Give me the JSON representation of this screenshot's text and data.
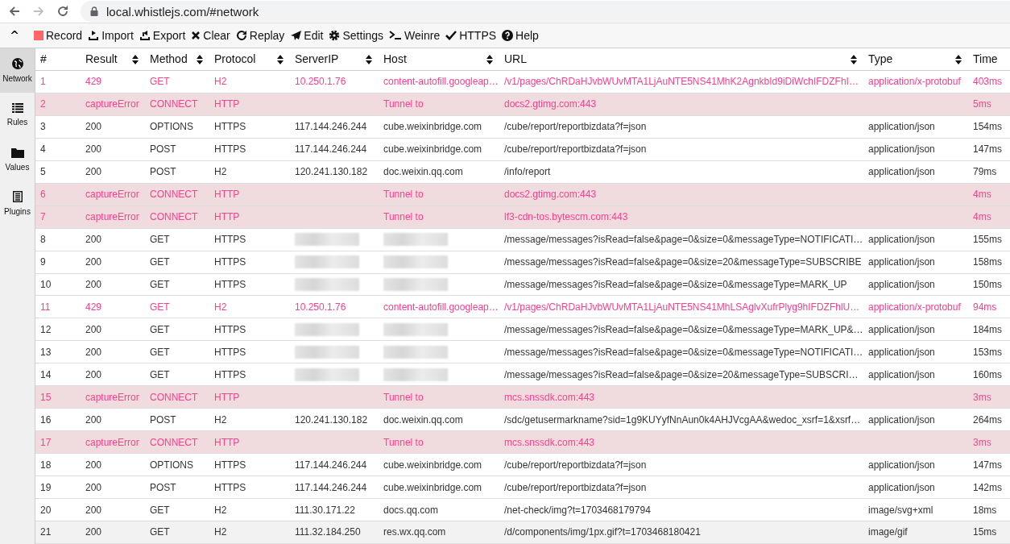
{
  "browser": {
    "back_disabled": false,
    "forward_disabled": true,
    "url": "local.whistlejs.com/#network"
  },
  "toolbar": {
    "collapse": "^",
    "items": [
      {
        "label": "Record"
      },
      {
        "label": "Import"
      },
      {
        "label": "Export"
      },
      {
        "label": "Clear"
      },
      {
        "label": "Replay"
      },
      {
        "label": "Edit"
      },
      {
        "label": "Settings"
      },
      {
        "label": "Weinre"
      },
      {
        "label": "HTTPS"
      },
      {
        "label": "Help"
      }
    ]
  },
  "sidebar": {
    "items": [
      {
        "label": "Network",
        "selected": true
      },
      {
        "label": "Rules",
        "selected": false
      },
      {
        "label": "Values",
        "selected": false
      },
      {
        "label": "Plugins",
        "selected": false
      }
    ]
  },
  "table": {
    "columns": [
      {
        "label": "#",
        "sortable": false
      },
      {
        "label": "Result",
        "sortable": true
      },
      {
        "label": "Method",
        "sortable": true
      },
      {
        "label": "Protocol",
        "sortable": true
      },
      {
        "label": "ServerIP",
        "sortable": true
      },
      {
        "label": "Host",
        "sortable": true
      },
      {
        "label": "URL",
        "sortable": true
      },
      {
        "label": "Type",
        "sortable": true
      },
      {
        "label": "Time",
        "sortable": false
      }
    ],
    "rows": [
      {
        "kind": "warning",
        "selected": false,
        "redacted": false,
        "cells": [
          "1",
          "429",
          "GET",
          "H2",
          "10.250.1.76",
          "content-autofill.googleap…",
          "/v1/pages/ChRDaHJvbWUvMTA1LjAuNTE5NS41MhK2AgnkbId9iDiWchIFDZFhI…",
          "application/x-protobuf",
          "403ms"
        ]
      },
      {
        "kind": "error",
        "selected": false,
        "redacted": false,
        "cells": [
          "2",
          "captureError",
          "CONNECT",
          "HTTP",
          "",
          "Tunnel to",
          "docs2.gtimg.com:443",
          "",
          "5ms"
        ]
      },
      {
        "kind": "normal",
        "selected": false,
        "redacted": false,
        "cells": [
          "3",
          "200",
          "OPTIONS",
          "HTTPS",
          "117.144.246.244",
          "cube.weixinbridge.com",
          "/cube/report/reportbizdata?f=json",
          "application/json",
          "154ms"
        ]
      },
      {
        "kind": "normal",
        "selected": false,
        "redacted": false,
        "cells": [
          "4",
          "200",
          "POST",
          "HTTPS",
          "117.144.246.244",
          "cube.weixinbridge.com",
          "/cube/report/reportbizdata?f=json",
          "application/json",
          "147ms"
        ]
      },
      {
        "kind": "normal",
        "selected": false,
        "redacted": false,
        "cells": [
          "5",
          "200",
          "POST",
          "H2",
          "120.241.130.182",
          "doc.weixin.qq.com",
          "/info/report",
          "application/json",
          "79ms"
        ]
      },
      {
        "kind": "error",
        "selected": false,
        "redacted": false,
        "cells": [
          "6",
          "captureError",
          "CONNECT",
          "HTTP",
          "",
          "Tunnel to",
          "docs2.gtimg.com:443",
          "",
          "4ms"
        ]
      },
      {
        "kind": "error",
        "selected": false,
        "redacted": false,
        "cells": [
          "7",
          "captureError",
          "CONNECT",
          "HTTP",
          "",
          "Tunnel to",
          "lf3-cdn-tos.bytescm.com:443",
          "",
          "4ms"
        ]
      },
      {
        "kind": "normal",
        "selected": false,
        "redacted": true,
        "cells": [
          "8",
          "200",
          "GET",
          "HTTPS",
          "",
          "",
          "/message/messages?isRead=false&page=0&size=0&messageType=NOTIFICATI…",
          "application/json",
          "155ms"
        ]
      },
      {
        "kind": "normal",
        "selected": false,
        "redacted": true,
        "cells": [
          "9",
          "200",
          "GET",
          "HTTPS",
          "",
          "",
          "/message/messages?isRead=false&page=0&size=20&messageType=SUBSCRIBE",
          "application/json",
          "158ms"
        ]
      },
      {
        "kind": "normal",
        "selected": false,
        "redacted": true,
        "cells": [
          "10",
          "200",
          "GET",
          "HTTPS",
          "",
          "",
          "/message/messages?isRead=false&page=0&size=0&messageType=MARK_UP",
          "application/json",
          "150ms"
        ]
      },
      {
        "kind": "warning",
        "selected": false,
        "redacted": false,
        "cells": [
          "11",
          "429",
          "GET",
          "H2",
          "10.250.1.76",
          "content-autofill.googleap…",
          "/v1/pages/ChRDaHJvbWUvMTA1LjAuNTE5NS41MhLSAglvXufrPlyg9hIFDZFhlU…",
          "application/x-protobuf",
          "94ms"
        ]
      },
      {
        "kind": "normal",
        "selected": false,
        "redacted": true,
        "cells": [
          "12",
          "200",
          "GET",
          "HTTPS",
          "",
          "",
          "/message/messages?isRead=false&page=0&size=0&messageType=MARK_UP&…",
          "application/json",
          "184ms"
        ]
      },
      {
        "kind": "normal",
        "selected": false,
        "redacted": true,
        "cells": [
          "13",
          "200",
          "GET",
          "HTTPS",
          "",
          "",
          "/message/messages?isRead=false&page=0&size=0&messageType=NOTIFICATI…",
          "application/json",
          "153ms"
        ]
      },
      {
        "kind": "normal",
        "selected": false,
        "redacted": true,
        "cells": [
          "14",
          "200",
          "GET",
          "HTTPS",
          "",
          "",
          "/message/messages?isRead=false&page=0&size=20&messageType=SUBSCRI…",
          "application/json",
          "160ms"
        ]
      },
      {
        "kind": "error",
        "selected": false,
        "redacted": false,
        "cells": [
          "15",
          "captureError",
          "CONNECT",
          "HTTP",
          "",
          "Tunnel to",
          "mcs.snssdk.com:443",
          "",
          "3ms"
        ]
      },
      {
        "kind": "normal",
        "selected": false,
        "redacted": false,
        "cells": [
          "16",
          "200",
          "POST",
          "H2",
          "120.241.130.182",
          "doc.weixin.qq.com",
          "/sdc/getusermarkname?sid=1g9KUYyfNnAun0k4AHJVcgAA&wedoc_xsrf=1&xsrf…",
          "application/json",
          "264ms"
        ]
      },
      {
        "kind": "error",
        "selected": false,
        "redacted": false,
        "cells": [
          "17",
          "captureError",
          "CONNECT",
          "HTTP",
          "",
          "Tunnel to",
          "mcs.snssdk.com:443",
          "",
          "3ms"
        ]
      },
      {
        "kind": "normal",
        "selected": false,
        "redacted": false,
        "cells": [
          "18",
          "200",
          "OPTIONS",
          "HTTPS",
          "117.144.246.244",
          "cube.weixinbridge.com",
          "/cube/report/reportbizdata?f=json",
          "application/json",
          "147ms"
        ]
      },
      {
        "kind": "normal",
        "selected": false,
        "redacted": false,
        "cells": [
          "19",
          "200",
          "POST",
          "HTTPS",
          "117.144.246.244",
          "cube.weixinbridge.com",
          "/cube/report/reportbizdata?f=json",
          "application/json",
          "142ms"
        ]
      },
      {
        "kind": "normal",
        "selected": false,
        "redacted": false,
        "cells": [
          "20",
          "200",
          "GET",
          "H2",
          "111.30.171.22",
          "docs.qq.com",
          "/net-check/img?t=1703468179794",
          "image/svg+xml",
          "18ms"
        ]
      },
      {
        "kind": "normal",
        "selected": true,
        "redacted": false,
        "cells": [
          "21",
          "200",
          "GET",
          "H2",
          "111.32.184.250",
          "res.wx.qq.com",
          "/d/components/img/1px.gif?t=1703468180421",
          "image/gif",
          "15ms"
        ]
      }
    ]
  }
}
